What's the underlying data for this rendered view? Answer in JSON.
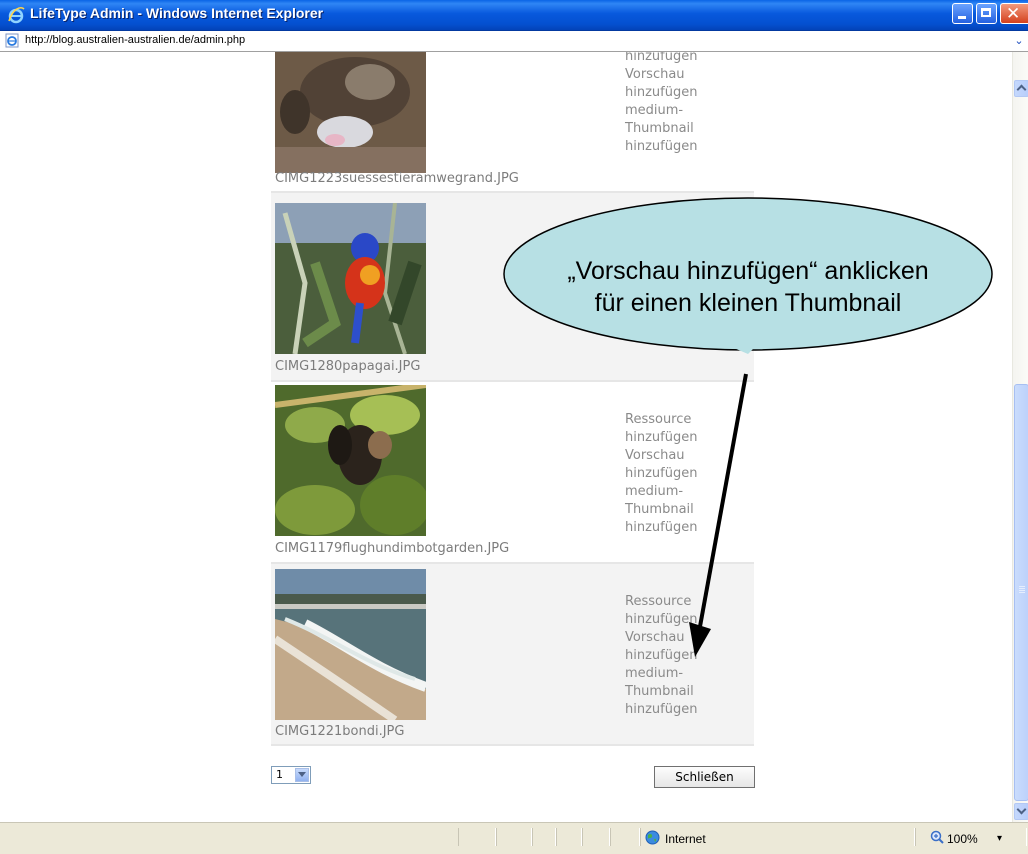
{
  "window": {
    "title": "LifeType Admin - Windows Internet Explorer",
    "close_glyph": "✕"
  },
  "address": {
    "url": "http://blog.australien-australien.de/admin.php"
  },
  "items": [
    {
      "filename": "CIMG1223suessestieramwegrand.JPG",
      "actions": [
        "hinzufügen",
        "Vorschau",
        "hinzufügen",
        "medium-",
        "Thumbnail",
        "hinzufügen"
      ]
    },
    {
      "filename": "CIMG1280papagai.JPG",
      "actions": []
    },
    {
      "filename": "CIMG1179flughundimbotgarden.JPG",
      "actions": [
        "Ressource",
        "hinzufügen",
        "Vorschau",
        "hinzufügen",
        "medium-",
        "Thumbnail",
        "hinzufügen"
      ]
    },
    {
      "filename": "CIMG1221bondi.JPG",
      "actions": [
        "Ressource",
        "hinzufügen",
        "Vorschau",
        "hinzufügen",
        "medium-",
        "Thumbnail",
        "hinzufügen"
      ]
    }
  ],
  "pager": {
    "value": "1"
  },
  "close_button": "Schließen",
  "callout": {
    "line1": "„Vorschau hinzufügen“ anklicken",
    "line2": "für einen kleinen Thumbnail"
  },
  "status": {
    "zone": "Internet",
    "zoom": "100%",
    "zoom_drop": "▾"
  },
  "colors": {
    "titlebar": "#0450d0",
    "bubble_fill": "#b7e0e4",
    "statusbar": "#ece9d8"
  }
}
